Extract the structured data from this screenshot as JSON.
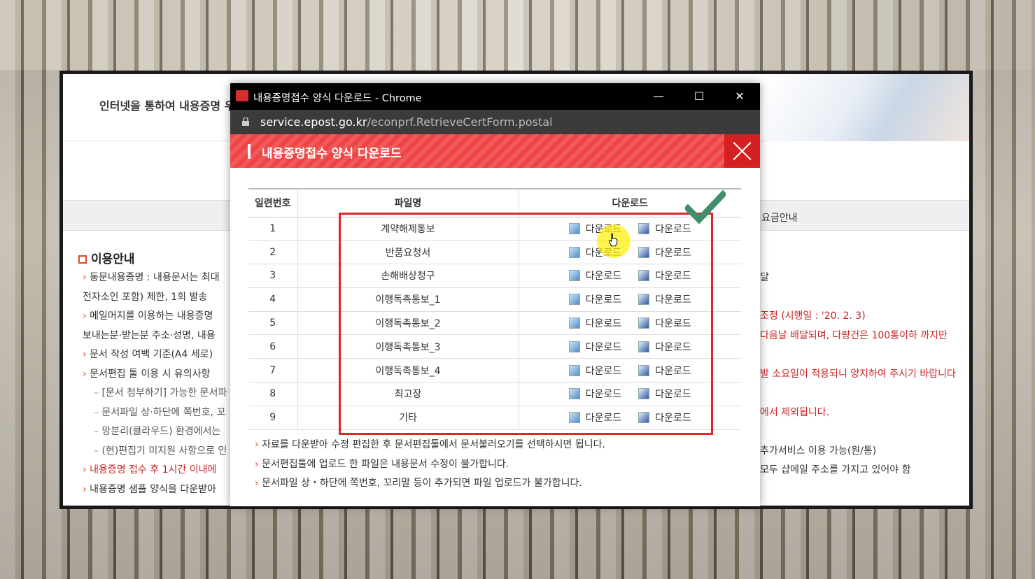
{
  "page": {
    "intro": "인터넷을 통하여 내용증명 우",
    "nav_item": "요금안내",
    "info_title": "이용안내",
    "info_items": [
      {
        "text": "동문내용증명 : 내용문서는 최대",
        "cls": "li"
      },
      {
        "text": "전자소인 포함) 제한, 1회 발송",
        "cls": ""
      },
      {
        "text": "메일머지를 이용하는 내용증명",
        "cls": "li"
      },
      {
        "text": "보내는분·받는분 주소·성명, 내용",
        "cls": ""
      },
      {
        "text": "문서 작성 여백 기준(A4 세로)",
        "cls": "li"
      },
      {
        "text": "문서편집 툴 이용 시 유의사항",
        "cls": "li"
      },
      {
        "text": "[문서 첨부하기] 가능한 문서파",
        "cls": "sub"
      },
      {
        "text": "문서파일 상·하단에 쪽번호, 꼬",
        "cls": "sub"
      },
      {
        "text": "망분리(클라우드) 환경에서는",
        "cls": "sub"
      },
      {
        "text": "(현)편집기 미지원 사항으로 인",
        "cls": "sub"
      },
      {
        "text": "내용증명 접수 후 1시간 이내에",
        "cls": "li red"
      },
      {
        "text": "내용증명 샘플 양식을 다운받아",
        "cls": "li"
      }
    ],
    "right_items": [
      {
        "text": "달",
        "cls": ""
      },
      {
        "text": "",
        "cls": ""
      },
      {
        "text": "조정 (시행일 : '20. 2. 3)",
        "cls": "red"
      },
      {
        "text": "다음날 배달되며, 다량건은 100통이하 까지만",
        "cls": "red"
      },
      {
        "text": "",
        "cls": ""
      },
      {
        "text": "발 소요일이 적용되니 양지하여 주시기 바랍니다",
        "cls": "red"
      },
      {
        "text": "",
        "cls": ""
      },
      {
        "text": "에서 제외됩니다.",
        "cls": "red"
      },
      {
        "text": "",
        "cls": ""
      },
      {
        "text": "추가서비스 이용 가능(원/통)",
        "cls": ""
      },
      {
        "text": "모두 샵메일 주소를 가지고 있어야 함",
        "cls": ""
      }
    ]
  },
  "window": {
    "title": "내용증명접수 양식 다운로드 - Chrome",
    "url_host": "service.epost.go.kr",
    "url_path": "/econprf.RetrieveCertForm.postal",
    "minimize": "—",
    "maximize": "☐",
    "close": "✕"
  },
  "popup": {
    "title": "내용증명접수 양식 다운로드",
    "columns": [
      "일련번호",
      "파일명",
      "다운로드"
    ],
    "download_label": "다운로드",
    "rows": [
      {
        "no": "1",
        "name": "계약해제통보"
      },
      {
        "no": "2",
        "name": "반품요청서"
      },
      {
        "no": "3",
        "name": "손해배상청구"
      },
      {
        "no": "4",
        "name": "이행독촉통보_1"
      },
      {
        "no": "5",
        "name": "이행독촉통보_2"
      },
      {
        "no": "6",
        "name": "이행독촉통보_3"
      },
      {
        "no": "7",
        "name": "이행독촉통보_4"
      },
      {
        "no": "8",
        "name": "최고장"
      },
      {
        "no": "9",
        "name": "기타"
      }
    ],
    "notes": [
      "자료를 다운받아 수정 편집한 후 문서편집툴에서 문서불러오기를 선택하시면 됩니다.",
      "문서편집툴에 업로드 한 파일은 내용문서 수정이 불가합니다.",
      "문서파일 상・하단에 쪽번호, 꼬리말 등이 추가되면 파일 업로드가 불가합니다."
    ]
  },
  "colors": {
    "accent_red": "#ef4444",
    "highlight_box": "#e0252b",
    "check_green": "#3f8f6a"
  },
  "icons": [
    "app-icon",
    "lock-icon",
    "hwp-file-icon",
    "word-file-icon",
    "checkmark-icon",
    "pointer-cursor-icon"
  ]
}
